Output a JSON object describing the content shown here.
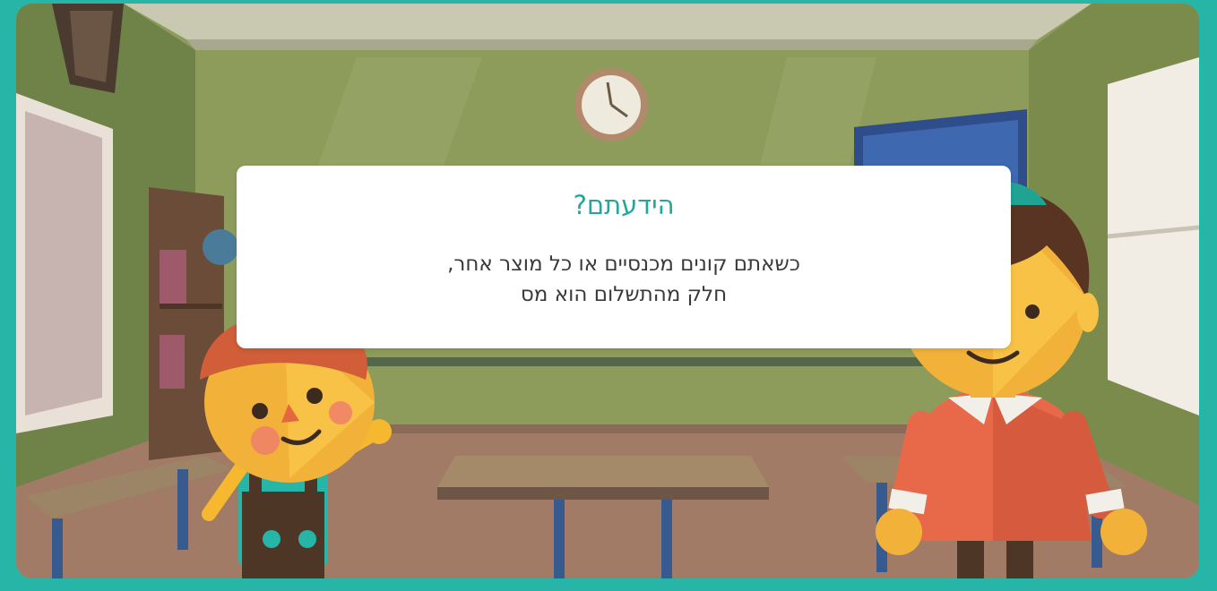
{
  "card": {
    "title": "הידעתם?",
    "body_line1": "כשאתם קונים מכנסיים או כל מוצר אחר,",
    "body_line2": "חלק מהתשלום הוא מס"
  },
  "colors": {
    "frame": "#26b5a6",
    "title": "#21a89a",
    "wall": "#8a9a58",
    "floor": "#a27b66"
  },
  "scene": {
    "setting": "classroom",
    "characters": [
      "boy-with-cap",
      "boy-with-kippah"
    ]
  }
}
